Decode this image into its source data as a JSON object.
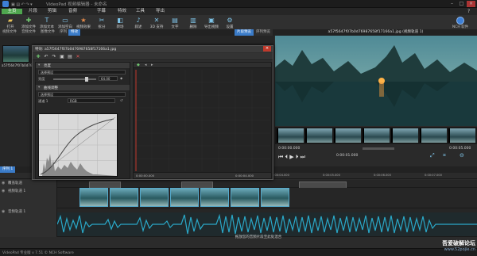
{
  "window": {
    "title": "VideoPad 视频编辑器 - 未命名"
  },
  "menu": {
    "home": "主页",
    "items": [
      "片段",
      "剪辑",
      "音频",
      "字幕",
      "特效",
      "工具",
      "导出"
    ]
  },
  "toolbar": {
    "items": [
      {
        "label": "打开",
        "icon": "folder-icon"
      },
      {
        "label": "添加文件",
        "icon": "add-files-icon"
      },
      {
        "label": "添加文本",
        "icon": "add-text-icon"
      },
      {
        "label": "添加空白",
        "icon": "blank-icon"
      },
      {
        "label": "视频效果",
        "icon": "video-effects-icon"
      },
      {
        "label": "拆分",
        "icon": "split-icon"
      },
      {
        "label": "转场",
        "icon": "transition-icon"
      },
      {
        "label": "叙述",
        "icon": "narrate-icon"
      },
      {
        "label": "3D 支持",
        "icon": "3d-icon"
      },
      {
        "label": "文字",
        "icon": "caption-icon"
      },
      {
        "label": "删除",
        "icon": "delete-icon"
      },
      {
        "label": "导出视频",
        "icon": "export-video-icon"
      },
      {
        "label": "设置",
        "icon": "settings-icon"
      }
    ],
    "brand": "NCH 软件"
  },
  "bin": {
    "tabs": [
      "视频文件",
      "音频文件",
      "图像文件",
      "序列",
      "特效"
    ],
    "active_tab": "特效",
    "thumb_label": "a57f5647f07b0d76987658f17166a1.jpg"
  },
  "dialog": {
    "title": "特效: a57f5647f07b0d76987658f17166a1.jpg",
    "toolbar_buttons": [
      "add-effect-icon",
      "undo-icon",
      "redo-icon",
      "copy-icon",
      "paste-icon",
      "delete-effect-icon"
    ],
    "section1": {
      "title": "亮度",
      "preset_label": "选择预设",
      "value_label": "亮度",
      "value": "64.00"
    },
    "section2": {
      "title": "曲线调整",
      "preset_label": "选择预设",
      "channel_label": "通道 1",
      "channel_value": "RGB"
    },
    "keyframe_time_start": "0:00:00.000",
    "keyframe_time_end": "0:00:04.000"
  },
  "preview": {
    "tabs": [
      "片段预览",
      "序列预览"
    ],
    "active_tab": "片段预览",
    "title": "a57f5647f07b0d76987658f17166a1.jpg (视频轨道 1)",
    "timecode_start": "0:00:00.000",
    "timecode_current": "0:00:01.000",
    "timecode_end": "0:00:05.000",
    "buttons": [
      {
        "label": "播放"
      },
      {
        "label": "全屏"
      },
      {
        "label": "裁剪"
      },
      {
        "label": "缩小"
      }
    ]
  },
  "timeline": {
    "tabs": [
      "序列 1"
    ],
    "ruler_ticks": [
      "0:00:00.000",
      "0:00:01.000",
      "0:00:02.000",
      "0:00:03.000",
      "0:00:04.000",
      "0:00:05.000",
      "0:00:06.000",
      "0:00:07.000",
      "0:00:08.000"
    ],
    "tracks": {
      "overlay": "覆盖轨道",
      "video": "视频轨道 1",
      "audio": "音频轨道 1"
    },
    "hint": "拖放您的音频片段至此处混合"
  },
  "status": {
    "text": "VideoPad 专业版 v 7.51 © NCH Software"
  },
  "watermark": {
    "line1": "吾爱破解论坛",
    "line2": "www.52pojie.cn"
  },
  "colors": {
    "accent": "#3a7bc8",
    "home_green": "#4fa64f",
    "wave": "#2aa8c8"
  }
}
